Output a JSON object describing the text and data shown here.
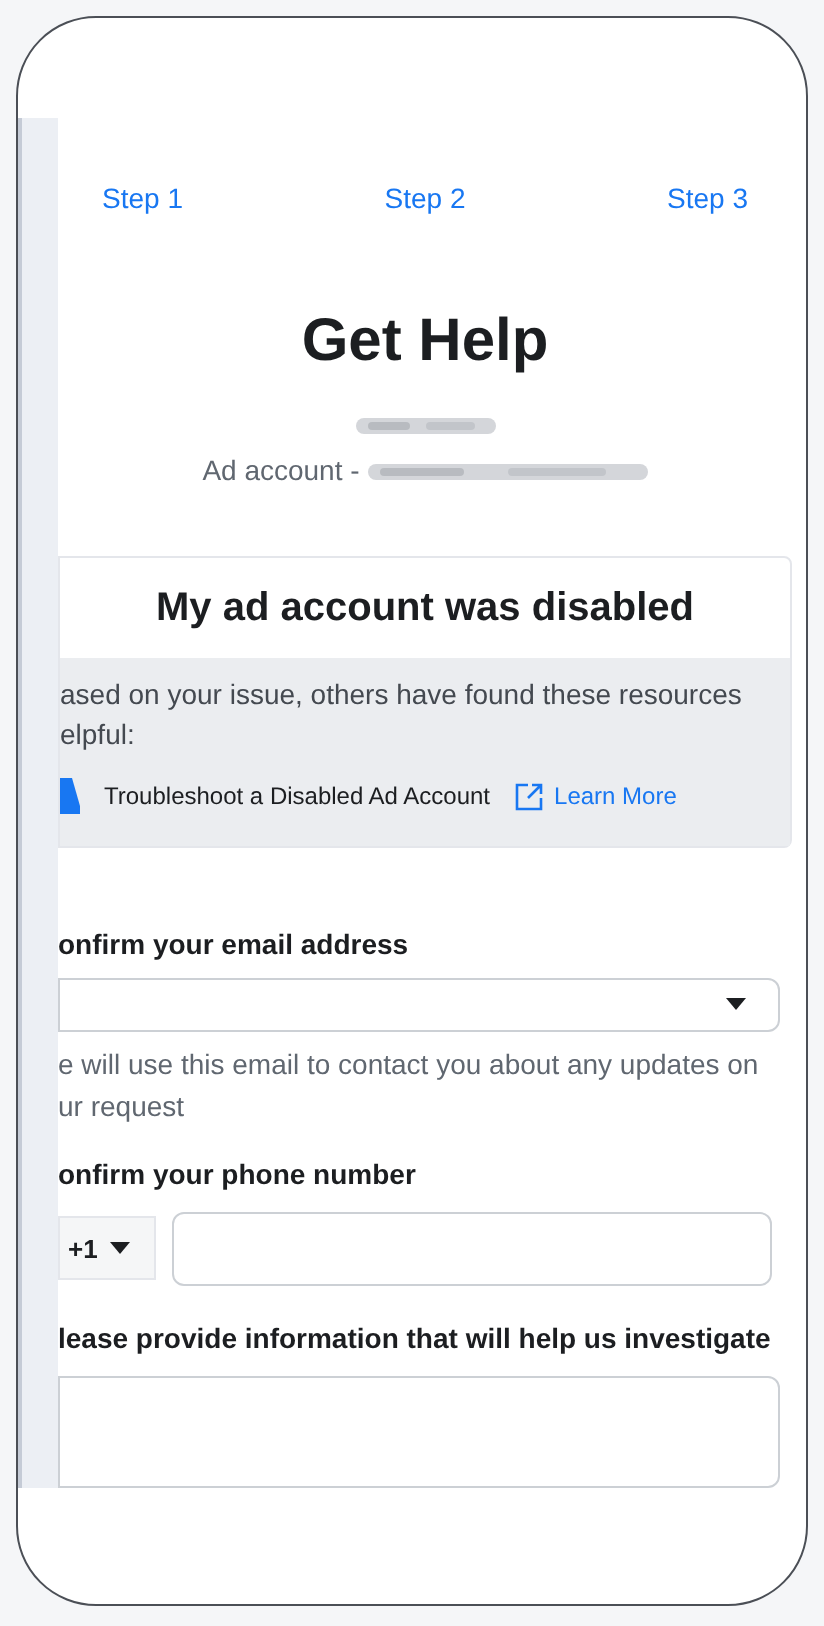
{
  "steps": [
    {
      "label": "Step 1"
    },
    {
      "label": "Step 2"
    },
    {
      "label": "Step 3"
    }
  ],
  "title": "Get Help",
  "account_label": "Ad account -",
  "card": {
    "title": "My ad account was disabled",
    "message": "ased on your issue, others have found these resources elpful:",
    "resource": {
      "label": "Troubleshoot a Disabled Ad Account",
      "link": "Learn More"
    }
  },
  "form": {
    "email": {
      "label": "onfirm your email address",
      "helper": [
        "e will use this email to contact you about any updates on",
        "ur request"
      ]
    },
    "phone": {
      "label": "onfirm your phone number",
      "country_code": "+1"
    },
    "info": {
      "label": "lease provide information that will help us investigate"
    }
  }
}
